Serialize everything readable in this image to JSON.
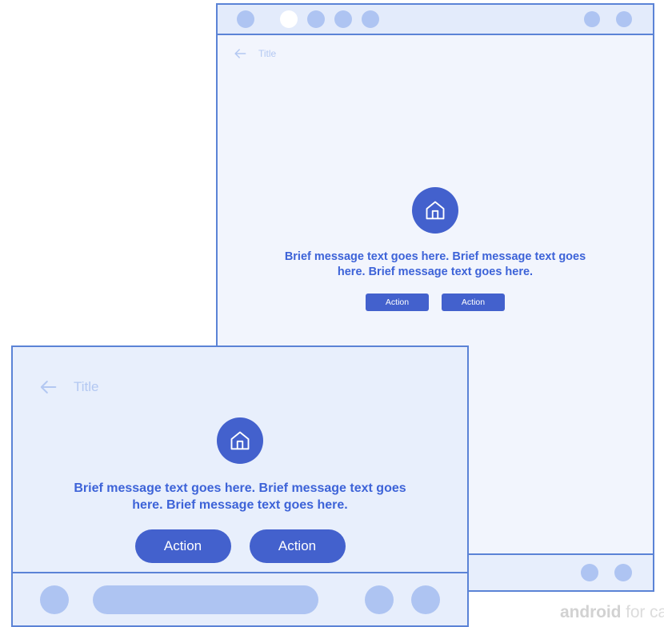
{
  "colors": {
    "accent_blue": "#4361cd",
    "window_border": "#5b83d6",
    "light_blue_shape": "#aec4f2",
    "window_bg": "#f2f5fd",
    "titlebar_bg": "#e3ebfb",
    "message_text": "#3d63d8",
    "title_text": "#b3c8f2",
    "watermark": "#dcdcdc"
  },
  "back_window": {
    "titlebar": {
      "left_dots": [
        {
          "name": "tab-dot-1",
          "state": "inactive"
        },
        {
          "name": "tab-dot-2",
          "state": "active"
        },
        {
          "name": "tab-dot-3",
          "state": "inactive"
        },
        {
          "name": "tab-dot-4",
          "state": "inactive"
        },
        {
          "name": "tab-dot-5",
          "state": "inactive"
        }
      ],
      "right_dots": [
        {
          "name": "titlebar-action-1"
        },
        {
          "name": "titlebar-action-2"
        }
      ]
    },
    "appbar": {
      "back_icon": "arrow-left-icon",
      "title": "Title"
    },
    "empty_state": {
      "icon": "home-icon",
      "message": "Brief message text goes here. Brief message text goes here. Brief message text goes here.",
      "buttons": [
        {
          "label": "Action"
        },
        {
          "label": "Action"
        }
      ]
    },
    "bottom_bar": {
      "right_dots": [
        {
          "name": "nav-dot-1"
        },
        {
          "name": "nav-dot-2"
        }
      ]
    }
  },
  "front_window": {
    "appbar": {
      "back_icon": "arrow-left-icon",
      "title": "Title"
    },
    "empty_state": {
      "icon": "home-icon",
      "message": "Brief message text goes here. Brief message text goes here. Brief message text goes here.",
      "buttons": [
        {
          "label": "Action"
        },
        {
          "label": "Action"
        }
      ]
    },
    "bottom_bar": {
      "left_circle": "nav-circle-left",
      "search_pill": "search-bar-pill",
      "right_circles": [
        "nav-circle-right-1",
        "nav-circle-right-2"
      ]
    }
  },
  "watermark": {
    "bold_part": "android",
    "rest_part": " for ca"
  }
}
